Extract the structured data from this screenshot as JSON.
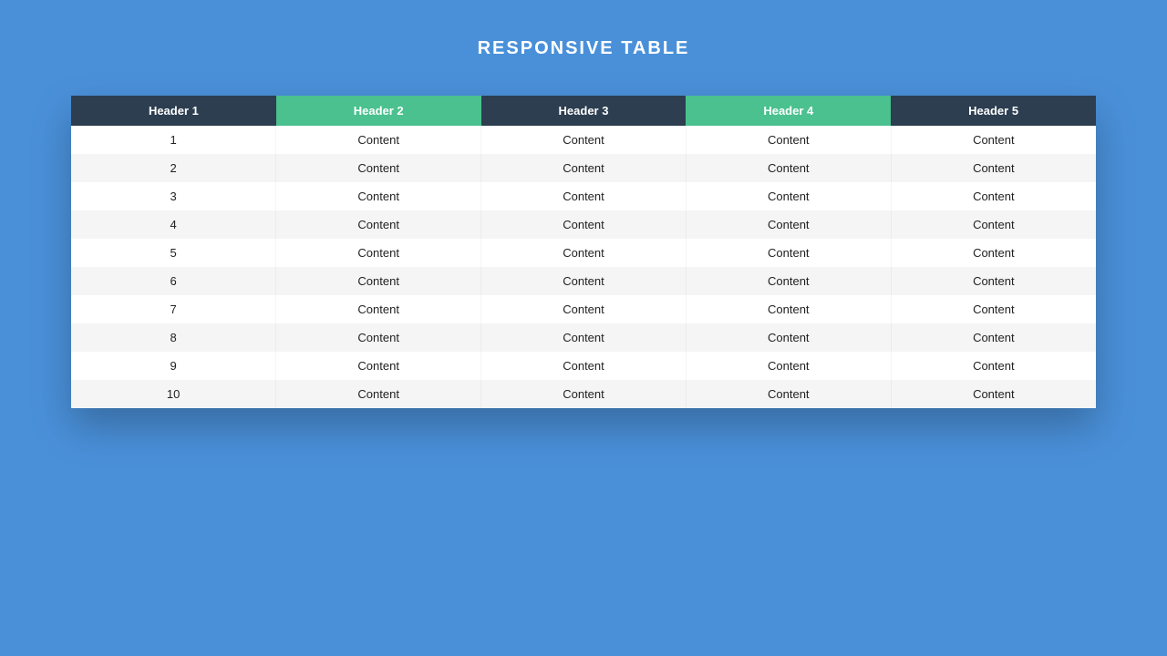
{
  "title": "RESPONSIVE TABLE",
  "headers": [
    "Header 1",
    "Header 2",
    "Header 3",
    "Header 4",
    "Header 5"
  ],
  "header_variants": [
    "dark",
    "green",
    "dark",
    "green",
    "dark"
  ],
  "rows": [
    [
      "1",
      "Content",
      "Content",
      "Content",
      "Content"
    ],
    [
      "2",
      "Content",
      "Content",
      "Content",
      "Content"
    ],
    [
      "3",
      "Content",
      "Content",
      "Content",
      "Content"
    ],
    [
      "4",
      "Content",
      "Content",
      "Content",
      "Content"
    ],
    [
      "5",
      "Content",
      "Content",
      "Content",
      "Content"
    ],
    [
      "6",
      "Content",
      "Content",
      "Content",
      "Content"
    ],
    [
      "7",
      "Content",
      "Content",
      "Content",
      "Content"
    ],
    [
      "8",
      "Content",
      "Content",
      "Content",
      "Content"
    ],
    [
      "9",
      "Content",
      "Content",
      "Content",
      "Content"
    ],
    [
      "10",
      "Content",
      "Content",
      "Content",
      "Content"
    ]
  ]
}
